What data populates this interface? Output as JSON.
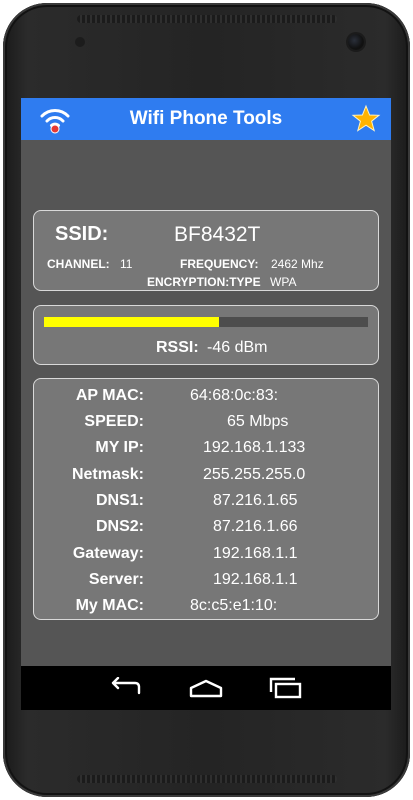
{
  "app": {
    "title": "Wifi Phone Tools",
    "accent_color": "#2f7cf0",
    "icons": {
      "left": "wifi-signal-icon",
      "right": "star-icon"
    }
  },
  "network": {
    "ssid_label": "SSID:",
    "ssid": "BF8432T",
    "channel_label": "CHANNEL:",
    "channel": "11",
    "frequency_label": "FREQUENCY:",
    "frequency": "2462  Mhz",
    "encryption_label": "ENCRYPTION:TYPE",
    "encryption": "WPA"
  },
  "signal": {
    "rssi_label": "RSSI:",
    "rssi": "-46  dBm",
    "strength_fraction": 0.54,
    "bar_color": "#ffff00"
  },
  "details": [
    {
      "label": "AP MAC:",
      "value": "64:68:0c:83:"
    },
    {
      "label": "SPEED:",
      "value": "65 Mbps"
    },
    {
      "label": "MY IP:",
      "value": "192.168.1.133"
    },
    {
      "label": "Netmask:",
      "value": "255.255.255.0"
    },
    {
      "label": "DNS1:",
      "value": "87.216.1.65"
    },
    {
      "label": "DNS2:",
      "value": "87.216.1.66"
    },
    {
      "label": "Gateway:",
      "value": "192.168.1.1"
    },
    {
      "label": "Server:",
      "value": "192.168.1.1"
    },
    {
      "label": "My MAC:",
      "value": "8c:c5:e1:10:"
    }
  ],
  "navbar": {
    "buttons": [
      "back-icon",
      "home-icon",
      "recent-apps-icon"
    ]
  }
}
